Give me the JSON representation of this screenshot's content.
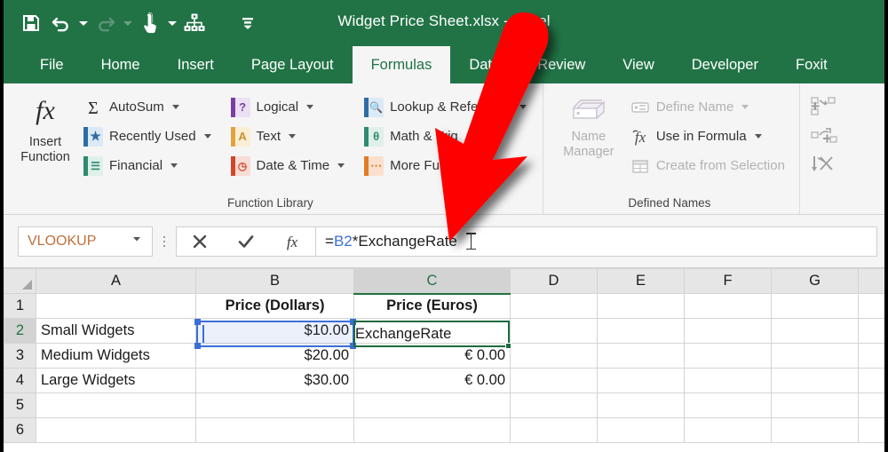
{
  "window": {
    "title": "Widget Price Sheet.xlsx - Excel",
    "accent_color": "#217346",
    "annotation_arrow_color": "#ff0000"
  },
  "quick_access_toolbar": {
    "items": [
      {
        "name": "save",
        "icon": "save-icon",
        "enabled": "true"
      },
      {
        "name": "undo",
        "icon": "undo-icon",
        "enabled": "true",
        "has_dropdown": "true"
      },
      {
        "name": "redo",
        "icon": "redo-icon",
        "enabled": "false",
        "has_dropdown": "true"
      },
      {
        "name": "touch-mouse-mode",
        "icon": "touch-mode-icon",
        "enabled": "true",
        "has_dropdown": "true"
      },
      {
        "name": "hierarchy",
        "icon": "hierarchy-icon",
        "enabled": "true"
      },
      {
        "name": "customize-quick-access-toolbar",
        "icon": "customize-qat-icon",
        "enabled": "true"
      }
    ]
  },
  "ribbon": {
    "tabs": [
      {
        "label": "File",
        "active": false
      },
      {
        "label": "Home",
        "active": false
      },
      {
        "label": "Insert",
        "active": false
      },
      {
        "label": "Page Layout",
        "active": false
      },
      {
        "label": "Formulas",
        "active": true
      },
      {
        "label": "Data",
        "active": false
      },
      {
        "label": "Review",
        "active": false
      },
      {
        "label": "View",
        "active": false
      },
      {
        "label": "Developer",
        "active": false
      },
      {
        "label": "Foxit",
        "active": false
      }
    ],
    "groups": [
      {
        "title": "Function Library",
        "insert_function": {
          "label_line1": "Insert",
          "label_line2": "Function",
          "icon": "fx-icon"
        },
        "column1": [
          {
            "label": "AutoSum",
            "icon": "sigma-icon",
            "dropdown": true,
            "color": "#333333",
            "dimmed": false
          },
          {
            "label": "Recently Used",
            "icon": "star-book-icon",
            "dropdown": true,
            "color": "#2e6da4",
            "dimmed": false
          },
          {
            "label": "Financial",
            "icon": "financial-book-icon",
            "dropdown": true,
            "color": "#2e8b6f",
            "dimmed": false
          }
        ],
        "column2": [
          {
            "label": "Logical",
            "icon": "logical-book-icon",
            "dropdown": true,
            "color": "#7a3fa0",
            "glyph": "?",
            "dimmed": false
          },
          {
            "label": "Text",
            "icon": "text-book-icon",
            "dropdown": true,
            "color": "#e0a33e",
            "glyph": "A",
            "dimmed": false
          },
          {
            "label": "Date & Time",
            "icon": "datetime-book-icon",
            "dropdown": true,
            "color": "#d0472b",
            "glyph": "◔",
            "dimmed": false
          }
        ],
        "column3": [
          {
            "label": "Lookup & Reference",
            "icon": "lookup-book-icon",
            "dropdown": true,
            "color": "#2e6da4",
            "glyph": "⚲",
            "dimmed": false
          },
          {
            "label": "Math & Trig",
            "icon": "math-book-icon",
            "dropdown": true,
            "color": "#2e8b6f",
            "glyph": "θ",
            "dimmed": false
          },
          {
            "label": "More Functions",
            "icon": "more-functions-book-icon",
            "dropdown": true,
            "color": "#e07b27",
            "glyph": "⋯",
            "dimmed": false
          }
        ]
      },
      {
        "title": "Defined Names",
        "name_manager": {
          "label_line1": "Name",
          "label_line2": "Manager",
          "icon": "name-manager-icon",
          "dimmed": true
        },
        "items": [
          {
            "label": "Define Name",
            "icon": "define-name-icon",
            "dropdown": true,
            "dimmed": true
          },
          {
            "label": "Use in Formula",
            "icon": "use-in-formula-icon",
            "dropdown": true,
            "dimmed": false
          },
          {
            "label": "Create from Selection",
            "icon": "create-from-selection-icon",
            "dropdown": false,
            "dimmed": true
          }
        ]
      },
      {
        "title": "",
        "auditing_icons": [
          {
            "name": "trace-precedents-icon"
          },
          {
            "name": "trace-dependents-icon"
          },
          {
            "name": "remove-arrows-icon"
          }
        ]
      }
    ]
  },
  "formula_bar": {
    "name_box_value": "VLOOKUP",
    "name_box_dropdown_icon": "chevron-down-icon",
    "cancel_icon": "cancel-x-icon",
    "enter_icon": "enter-check-icon",
    "insert_function_icon": "fx-icon",
    "formula_prefix": "= ",
    "formula_reference": "B2",
    "formula_rest": "*ExchangeRate",
    "formula_full": "=B2*ExchangeRate"
  },
  "sheet": {
    "column_headers": [
      "A",
      "B",
      "C",
      "D",
      "E",
      "F",
      "G",
      ""
    ],
    "selected_column": "C",
    "row_headers": [
      "1",
      "2",
      "3",
      "4",
      "5",
      "6"
    ],
    "selected_row": "2",
    "rows": [
      {
        "n": "1",
        "A": "",
        "B": "Price (Dollars)",
        "C": "Price (Euros)",
        "D": "",
        "E": "",
        "F": "",
        "G": "",
        "H": ""
      },
      {
        "n": "2",
        "A": "Small Widgets",
        "B": "$10.00",
        "C": "ExchangeRate",
        "D": "",
        "E": "",
        "F": "",
        "G": "",
        "H": ""
      },
      {
        "n": "3",
        "A": "Medium Widgets",
        "B": "$20.00",
        "C": "€ 0.00",
        "D": "",
        "E": "",
        "F": "",
        "G": "",
        "H": ""
      },
      {
        "n": "4",
        "A": "Large Widgets",
        "B": "$30.00",
        "C": "€ 0.00",
        "D": "",
        "E": "",
        "F": "",
        "G": "",
        "H": ""
      },
      {
        "n": "5",
        "A": "",
        "B": "",
        "C": "",
        "D": "",
        "E": "",
        "F": "",
        "G": "",
        "H": ""
      },
      {
        "n": "6",
        "A": "",
        "B": "",
        "C": "",
        "D": "",
        "E": "",
        "F": "",
        "G": "",
        "H": ""
      }
    ],
    "active_cell": "C2",
    "active_cell_editing_text": "ExchangeRate",
    "reference_cell": "B2",
    "reference_cell_color": "#3a6fd8",
    "active_cell_border_color": "#1e6b3f"
  }
}
